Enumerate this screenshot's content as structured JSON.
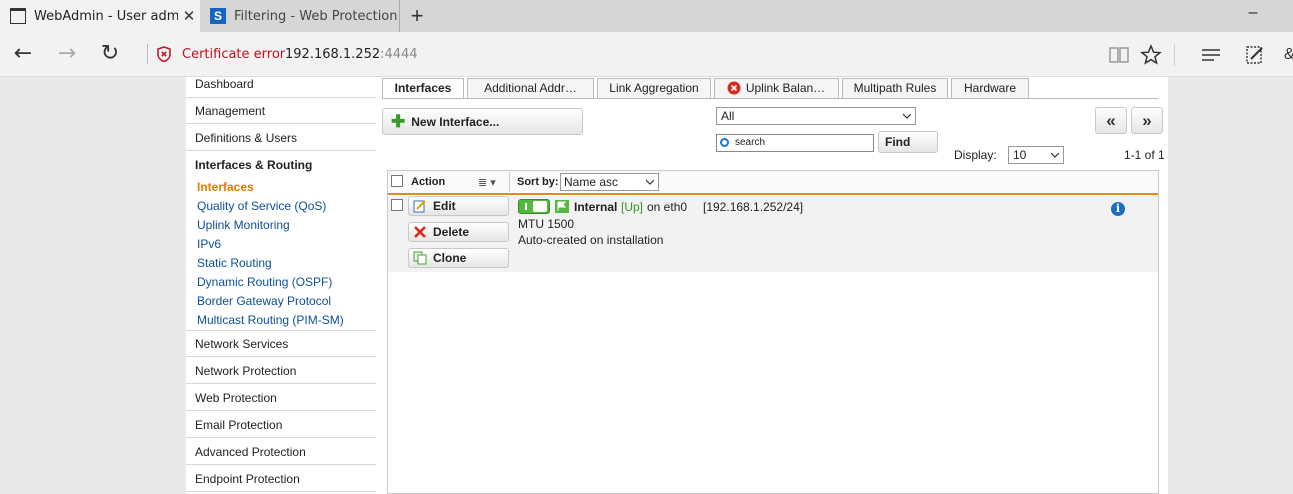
{
  "browser": {
    "tabs": [
      {
        "title": "WebAdmin - User admi",
        "active": true
      },
      {
        "title": "Filtering - Web Protection: \\",
        "active": false
      }
    ],
    "new_tab_label": "+",
    "minimize_label": "–",
    "nav": {
      "back": "←",
      "forward": "→",
      "refresh": "↻"
    },
    "cert_label": "Certificate error",
    "url_host": "192.168.1.252",
    "url_port": ":4444"
  },
  "sidebar": {
    "items_top": [
      "Dashboard",
      "Management",
      "Definitions & Users",
      "Interfaces & Routing"
    ],
    "subitems": [
      "Interfaces",
      "Quality of Service (QoS)",
      "Uplink Monitoring",
      "IPv6",
      "Static Routing",
      "Dynamic Routing (OSPF)",
      "Border Gateway Protocol",
      "Multicast Routing (PIM-SM)"
    ],
    "active_subitem": "Interfaces",
    "items_bottom": [
      "Network Services",
      "Network Protection",
      "Web Protection",
      "Email Protection",
      "Advanced Protection",
      "Endpoint Protection"
    ]
  },
  "content_tabs": [
    "Interfaces",
    "Additional Addr…",
    "Link Aggregation",
    "Uplink Balan…",
    "Multipath Rules",
    "Hardware"
  ],
  "toolbar": {
    "new_interface_label": "New Interface...",
    "filter_value": "All",
    "search_placeholder": "search",
    "find_label": "Find",
    "display_label": "Display:",
    "display_value": "10",
    "prev_label": "«",
    "next_label": "»",
    "page_info": "1-1 of 1"
  },
  "grid": {
    "action_header": "Action",
    "column_menu": "≣ ▾",
    "sort_label": "Sort by:",
    "sort_value": "Name asc",
    "rows": [
      {
        "actions": [
          "Edit",
          "Delete",
          "Clone"
        ],
        "enabled": true,
        "name": "Internal",
        "status": "[Up]",
        "device": "on eth0",
        "address": "[192.168.1.252/24]",
        "mtu": "MTU 1500",
        "comment": "Auto-created on installation",
        "info": "i"
      }
    ]
  },
  "colors": {
    "accent": "#e58a17",
    "link": "#0b4f9a",
    "active": "#e47a00",
    "status_up": "#2d9a1a",
    "error": "#c50f1f"
  },
  "icons": {
    "cert": "shield-error-icon",
    "plus": "plus-icon",
    "search": "search-icon",
    "edit": "edit-icon",
    "delete": "delete-icon",
    "clone": "clone-icon",
    "flag": "flag-icon",
    "info": "info-icon",
    "error": "error-icon"
  }
}
